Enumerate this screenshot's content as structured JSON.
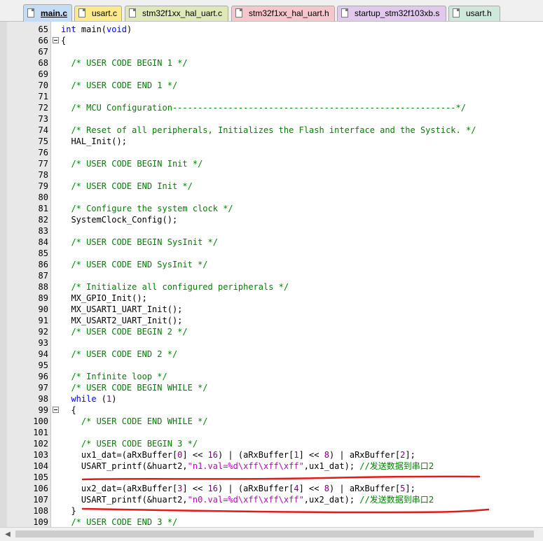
{
  "tabs": [
    {
      "label": "main.c",
      "color": "#c5dcf5",
      "active": true
    },
    {
      "label": "usart.c",
      "color": "#fbe98a",
      "active": false
    },
    {
      "label": "stm32f1xx_hal_uart.c",
      "color": "#dfe8b8",
      "active": false
    },
    {
      "label": "stm32f1xx_hal_uart.h",
      "color": "#f5c6cc",
      "active": false
    },
    {
      "label": "startup_stm32f103xb.s",
      "color": "#e0c9ec",
      "active": false
    },
    {
      "label": "usart.h",
      "color": "#cfe8dc",
      "active": false
    }
  ],
  "code_lines": [
    {
      "num": "65",
      "fold": false,
      "parts": [
        [
          "k",
          "int"
        ],
        [
          "t",
          " main("
        ],
        [
          "k",
          "void"
        ],
        [
          "t",
          ")"
        ]
      ]
    },
    {
      "num": "66",
      "fold": true,
      "parts": [
        [
          "t",
          "{"
        ]
      ]
    },
    {
      "num": "67",
      "fold": false,
      "parts": []
    },
    {
      "num": "68",
      "fold": false,
      "parts": [
        [
          "t",
          "  "
        ],
        [
          "c",
          "/* USER CODE BEGIN 1 */"
        ]
      ]
    },
    {
      "num": "69",
      "fold": false,
      "parts": []
    },
    {
      "num": "70",
      "fold": false,
      "parts": [
        [
          "t",
          "  "
        ],
        [
          "c",
          "/* USER CODE END 1 */"
        ]
      ]
    },
    {
      "num": "71",
      "fold": false,
      "parts": []
    },
    {
      "num": "72",
      "fold": false,
      "parts": [
        [
          "t",
          "  "
        ],
        [
          "c",
          "/* MCU Configuration--------------------------------------------------------*/"
        ]
      ]
    },
    {
      "num": "73",
      "fold": false,
      "parts": []
    },
    {
      "num": "74",
      "fold": false,
      "parts": [
        [
          "t",
          "  "
        ],
        [
          "c",
          "/* Reset of all peripherals, Initializes the Flash interface and the Systick. */"
        ]
      ]
    },
    {
      "num": "75",
      "fold": false,
      "parts": [
        [
          "t",
          "  HAL_Init();"
        ]
      ]
    },
    {
      "num": "76",
      "fold": false,
      "parts": []
    },
    {
      "num": "77",
      "fold": false,
      "parts": [
        [
          "t",
          "  "
        ],
        [
          "c",
          "/* USER CODE BEGIN Init */"
        ]
      ]
    },
    {
      "num": "78",
      "fold": false,
      "parts": []
    },
    {
      "num": "79",
      "fold": false,
      "parts": [
        [
          "t",
          "  "
        ],
        [
          "c",
          "/* USER CODE END Init */"
        ]
      ]
    },
    {
      "num": "80",
      "fold": false,
      "parts": []
    },
    {
      "num": "81",
      "fold": false,
      "parts": [
        [
          "t",
          "  "
        ],
        [
          "c",
          "/* Configure the system clock */"
        ]
      ]
    },
    {
      "num": "82",
      "fold": false,
      "parts": [
        [
          "t",
          "  SystemClock_Config();"
        ]
      ]
    },
    {
      "num": "83",
      "fold": false,
      "parts": []
    },
    {
      "num": "84",
      "fold": false,
      "parts": [
        [
          "t",
          "  "
        ],
        [
          "c",
          "/* USER CODE BEGIN SysInit */"
        ]
      ]
    },
    {
      "num": "85",
      "fold": false,
      "parts": []
    },
    {
      "num": "86",
      "fold": false,
      "parts": [
        [
          "t",
          "  "
        ],
        [
          "c",
          "/* USER CODE END SysInit */"
        ]
      ]
    },
    {
      "num": "87",
      "fold": false,
      "parts": []
    },
    {
      "num": "88",
      "fold": false,
      "parts": [
        [
          "t",
          "  "
        ],
        [
          "c",
          "/* Initialize all configured peripherals */"
        ]
      ]
    },
    {
      "num": "89",
      "fold": false,
      "parts": [
        [
          "t",
          "  MX_GPIO_Init();"
        ]
      ]
    },
    {
      "num": "90",
      "fold": false,
      "parts": [
        [
          "t",
          "  MX_USART1_UART_Init();"
        ]
      ]
    },
    {
      "num": "91",
      "fold": false,
      "parts": [
        [
          "t",
          "  MX_USART2_UART_Init();"
        ]
      ]
    },
    {
      "num": "92",
      "fold": false,
      "parts": [
        [
          "t",
          "  "
        ],
        [
          "c",
          "/* USER CODE BEGIN 2 */"
        ]
      ]
    },
    {
      "num": "93",
      "fold": false,
      "parts": []
    },
    {
      "num": "94",
      "fold": false,
      "parts": [
        [
          "t",
          "  "
        ],
        [
          "c",
          "/* USER CODE END 2 */"
        ]
      ]
    },
    {
      "num": "95",
      "fold": false,
      "parts": []
    },
    {
      "num": "96",
      "fold": false,
      "parts": [
        [
          "t",
          "  "
        ],
        [
          "c",
          "/* Infinite loop */"
        ]
      ]
    },
    {
      "num": "97",
      "fold": false,
      "parts": [
        [
          "t",
          "  "
        ],
        [
          "c",
          "/* USER CODE BEGIN WHILE */"
        ]
      ]
    },
    {
      "num": "98",
      "fold": false,
      "parts": [
        [
          "t",
          "  "
        ],
        [
          "k",
          "while"
        ],
        [
          "t",
          " ("
        ],
        [
          "n",
          "1"
        ],
        [
          "t",
          ")"
        ]
      ]
    },
    {
      "num": "99",
      "fold": true,
      "parts": [
        [
          "t",
          "  {"
        ]
      ]
    },
    {
      "num": "100",
      "fold": false,
      "parts": [
        [
          "t",
          "    "
        ],
        [
          "c",
          "/* USER CODE END WHILE */"
        ]
      ]
    },
    {
      "num": "101",
      "fold": false,
      "parts": []
    },
    {
      "num": "102",
      "fold": false,
      "parts": [
        [
          "t",
          "    "
        ],
        [
          "c",
          "/* USER CODE BEGIN 3 */"
        ]
      ]
    },
    {
      "num": "103",
      "fold": false,
      "parts": [
        [
          "t",
          "    ux1_dat=(aRxBuffer["
        ],
        [
          "n",
          "0"
        ],
        [
          "t",
          "] << "
        ],
        [
          "n",
          "16"
        ],
        [
          "t",
          ") | (aRxBuffer["
        ],
        [
          "n",
          "1"
        ],
        [
          "t",
          "] << "
        ],
        [
          "n",
          "8"
        ],
        [
          "t",
          ") | aRxBuffer["
        ],
        [
          "n",
          "2"
        ],
        [
          "t",
          "];"
        ]
      ]
    },
    {
      "num": "104",
      "fold": false,
      "parts": [
        [
          "t",
          "    USART_printf(&huart2,"
        ],
        [
          "s",
          "\"n1.val=%d\\xff\\xff\\xff\""
        ],
        [
          "t",
          ",ux1_dat); "
        ],
        [
          "c",
          "//"
        ],
        [
          "cjk",
          "发送数据到串口2"
        ]
      ]
    },
    {
      "num": "105",
      "fold": false,
      "parts": []
    },
    {
      "num": "106",
      "fold": false,
      "parts": [
        [
          "t",
          "    ux2_dat=(aRxBuffer["
        ],
        [
          "n",
          "3"
        ],
        [
          "t",
          "] << "
        ],
        [
          "n",
          "16"
        ],
        [
          "t",
          ") | (aRxBuffer["
        ],
        [
          "n",
          "4"
        ],
        [
          "t",
          "] << "
        ],
        [
          "n",
          "8"
        ],
        [
          "t",
          ") | aRxBuffer["
        ],
        [
          "n",
          "5"
        ],
        [
          "t",
          "];"
        ]
      ]
    },
    {
      "num": "107",
      "fold": false,
      "parts": [
        [
          "t",
          "    USART_printf(&huart2,"
        ],
        [
          "s",
          "\"n0.val=%d\\xff\\xff\\xff\""
        ],
        [
          "t",
          ",ux2_dat); "
        ],
        [
          "c",
          "//"
        ],
        [
          "cjk",
          "发送数据到串口2"
        ]
      ]
    },
    {
      "num": "108",
      "fold": false,
      "parts": [
        [
          "t",
          "  }"
        ]
      ]
    },
    {
      "num": "109",
      "fold": false,
      "parts": [
        [
          "t",
          "  "
        ],
        [
          "c",
          "/* USER CODE END 3 */"
        ]
      ]
    }
  ],
  "annotation_color": "#e31a1a",
  "syntax_colors": {
    "comment": "#008000",
    "keyword": "#0000ff",
    "number": "#800080",
    "string": "#c000c0"
  },
  "scroll_left_icon": "triangle-left-icon"
}
